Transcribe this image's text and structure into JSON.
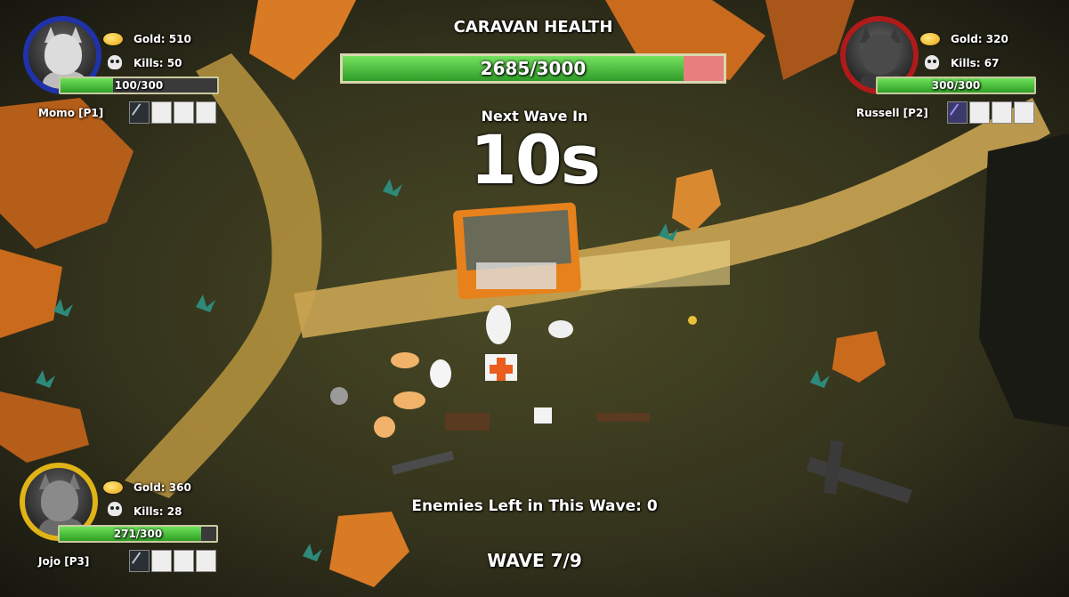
{
  "hud": {
    "caravan_title": "CARAVAN HEALTH",
    "caravan_health": "2685/3000",
    "caravan_health_fraction": 0.895,
    "next_wave_label": "Next Wave In",
    "countdown": "10s",
    "enemies_left": "Enemies Left in This Wave: 0",
    "wave": "WAVE 7/9"
  },
  "players": {
    "p1": {
      "name": "Momo [P1]",
      "gold": "Gold: 510",
      "kills": "Kills: 50",
      "hp": "100/300",
      "hp_fraction": 0.333,
      "ring_color": "#2032a8",
      "slots_filled": 1
    },
    "p2": {
      "name": "Russell [P2]",
      "gold": "Gold: 320",
      "kills": "Kills: 67",
      "hp": "300/300",
      "hp_fraction": 1.0,
      "ring_color": "#b01a1a",
      "slots_filled": 1
    },
    "p3": {
      "name": "Jojo [P3]",
      "gold": "Gold: 360",
      "kills": "Kills: 28",
      "hp": "271/300",
      "hp_fraction": 0.903,
      "ring_color": "#e0b317",
      "slots_filled": 1
    }
  },
  "icons": {
    "gold": "gold-coin-icon",
    "kills": "skull-icon",
    "weapon": "sword-icon"
  }
}
